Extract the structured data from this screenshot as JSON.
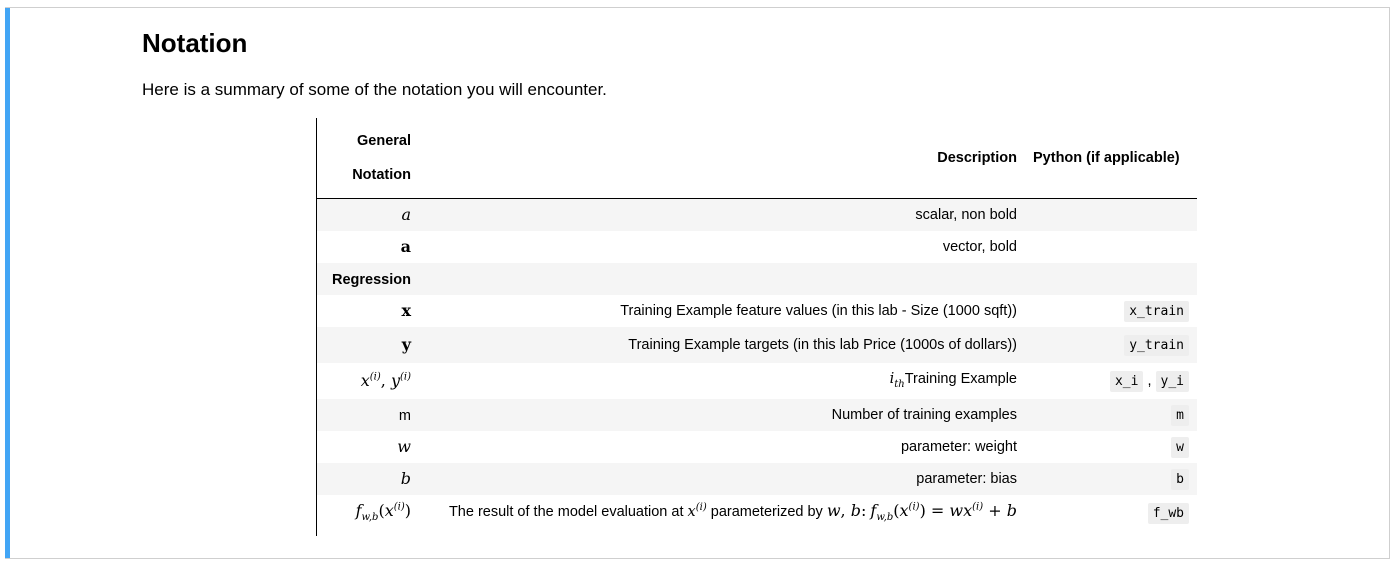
{
  "heading": "Notation",
  "intro": "Here is a summary of some of the notation you will encounter.",
  "table": {
    "headers": {
      "general_line1": "General",
      "general_line2": "Notation",
      "description": "Description",
      "python": "Python (if applicable)"
    },
    "rows": [
      {
        "notation": "a",
        "description": "scalar, non bold",
        "python": ""
      },
      {
        "notation": "a",
        "description": "vector, bold",
        "python": ""
      },
      {
        "notation": "Regression",
        "description": "",
        "python": ""
      },
      {
        "notation": "x",
        "description": "Training Example feature values (in this lab - Size (1000 sqft))",
        "python": "x_train"
      },
      {
        "notation": "y",
        "description": "Training Example targets (in this lab Price (1000s of dollars))",
        "python": "y_train"
      },
      {
        "notation": "x(i), y(i)",
        "description": "Training Example",
        "python_a": "x_i",
        "python_sep": ",",
        "python_b": "y_i"
      },
      {
        "notation": "m",
        "description": "Number of training examples",
        "python": "m"
      },
      {
        "notation": "w",
        "description": "parameter: weight",
        "python": "w"
      },
      {
        "notation": "b",
        "description": "parameter: bias",
        "python": "b"
      },
      {
        "notation": "fw,b(x(i))",
        "description_a": "The result of the model evaluation at",
        "description_b": "parameterized by",
        "python": "f_wb"
      }
    ],
    "math": {
      "i": "i",
      "th": "th",
      "w": "w",
      "b": "b",
      "f": "f",
      "wb": "w,b",
      "x": "x",
      "y": "y",
      "comma": ",",
      "colon": ":",
      "lparen": "(",
      "rparen": ")",
      "eq": "=",
      "plus": "+"
    }
  }
}
